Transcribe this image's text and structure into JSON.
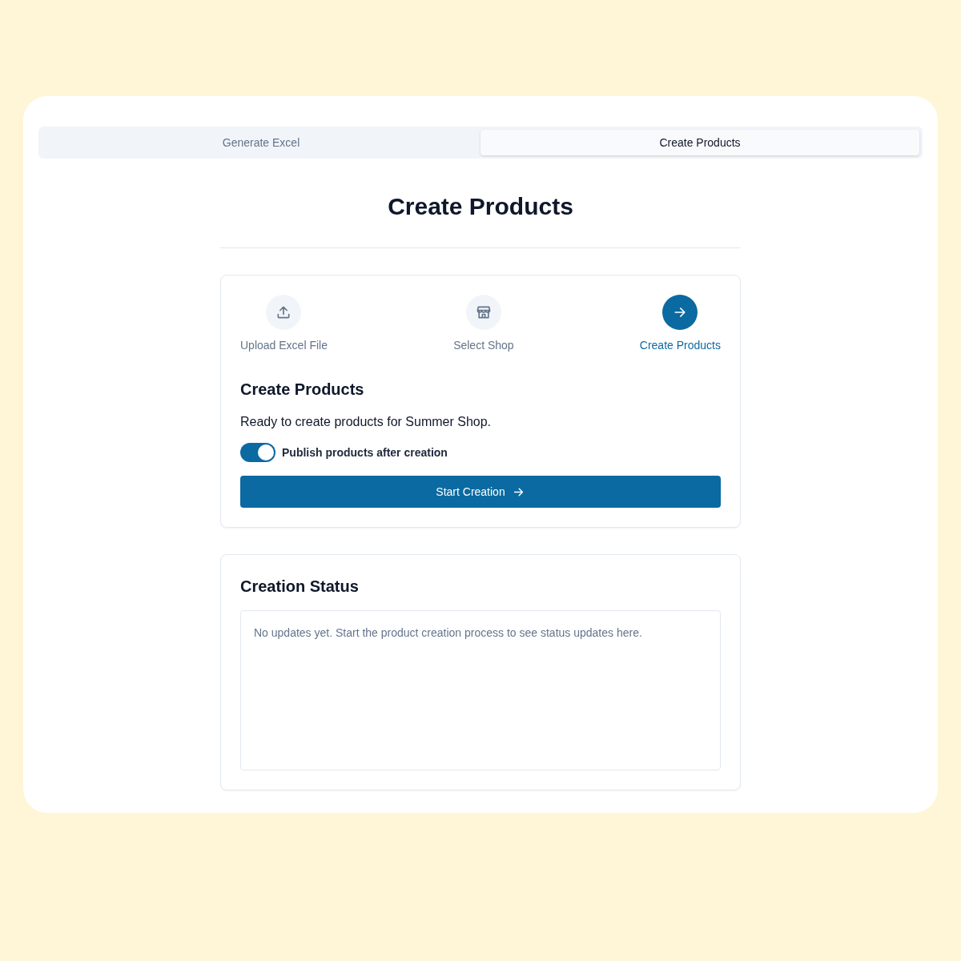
{
  "tabs": [
    {
      "label": "Generate Excel",
      "selected": false
    },
    {
      "label": "Create Products",
      "selected": true
    }
  ],
  "title": "Create Products",
  "steps": [
    {
      "label": "Upload Excel File",
      "active": false
    },
    {
      "label": "Select Shop",
      "active": false
    },
    {
      "label": "Create Products",
      "active": true
    }
  ],
  "panel": {
    "heading": "Create Products",
    "message": "Ready to create products for Summer Shop.",
    "toggle": {
      "label": "Publish products after creation",
      "on": true
    },
    "button": "Start Creation"
  },
  "status": {
    "heading": "Creation Status",
    "log": "No updates yet. Start the product creation process to see status updates here."
  }
}
